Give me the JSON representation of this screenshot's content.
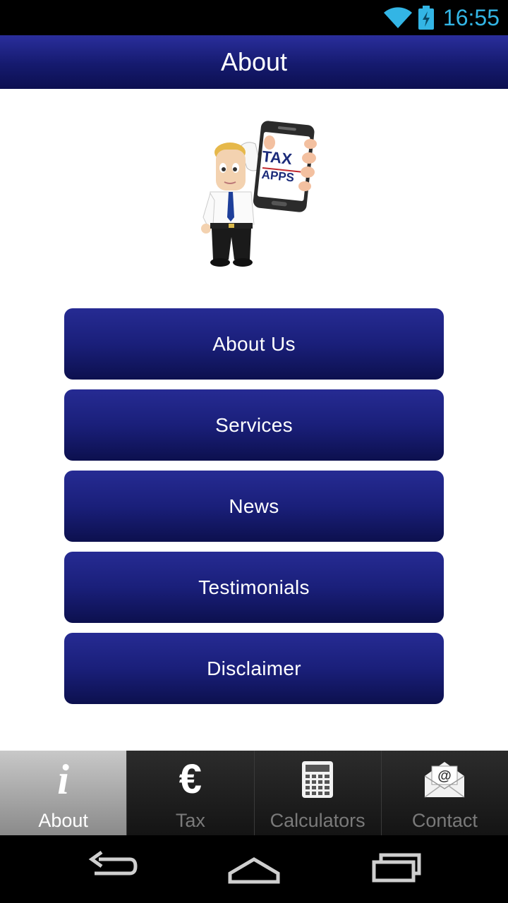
{
  "status_bar": {
    "time": "16:55",
    "icons": [
      "wifi-icon",
      "battery-icon"
    ],
    "accent_color": "#33b5e5"
  },
  "header": {
    "title": "About"
  },
  "logo": {
    "text_line1": "TAX",
    "text_line2": "APPS"
  },
  "menu": {
    "items": [
      {
        "label": "About Us"
      },
      {
        "label": "Services"
      },
      {
        "label": "News"
      },
      {
        "label": "Testimonials"
      },
      {
        "label": "Disclaimer"
      }
    ],
    "button_color": "#1a1f7a"
  },
  "tabs": {
    "items": [
      {
        "label": "About",
        "icon": "info-icon",
        "active": true
      },
      {
        "label": "Tax",
        "icon": "euro-icon",
        "active": false
      },
      {
        "label": "Calculators",
        "icon": "calculator-icon",
        "active": false
      },
      {
        "label": "Contact",
        "icon": "email-icon",
        "active": false
      }
    ]
  },
  "nav_bar": {
    "icons": [
      "back-icon",
      "home-icon",
      "recent-apps-icon"
    ]
  }
}
